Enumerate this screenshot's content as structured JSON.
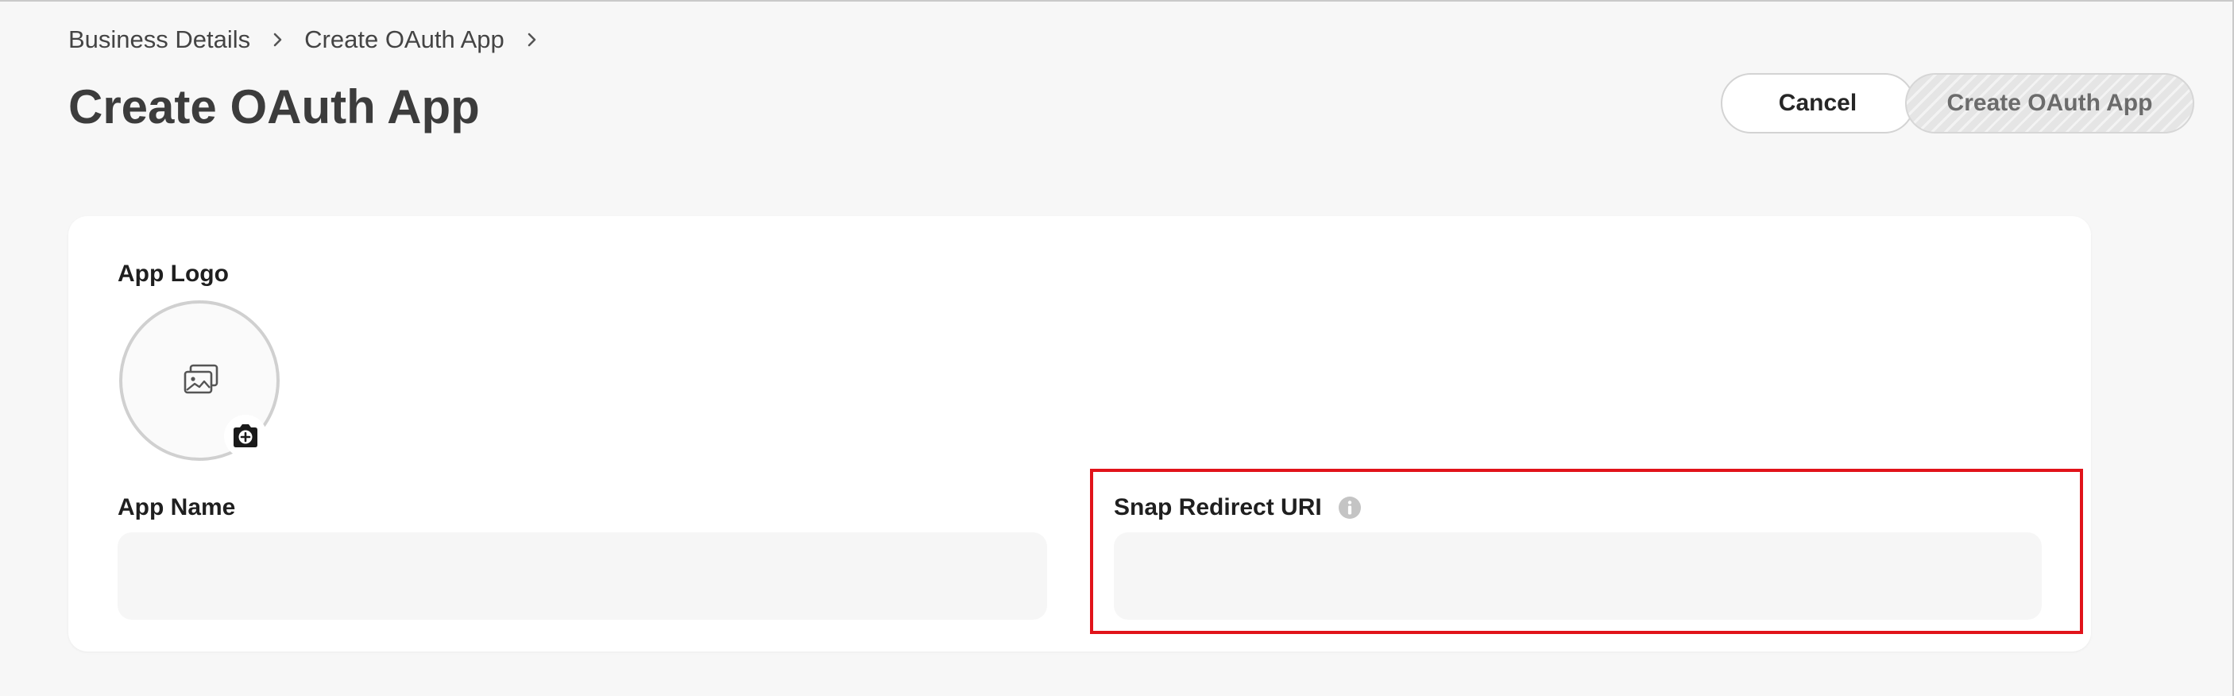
{
  "breadcrumb": {
    "items": [
      "Business Details",
      "Create OAuth App"
    ]
  },
  "page": {
    "title": "Create OAuth App"
  },
  "actions": {
    "cancel_label": "Cancel",
    "create_label": "Create OAuth App"
  },
  "form": {
    "app_logo": {
      "label": "App Logo",
      "placeholder_icon": "image-gallery-icon",
      "upload_icon": "camera-add-icon"
    },
    "app_name": {
      "label": "App Name",
      "value": "",
      "placeholder": ""
    },
    "snap_redirect_uri": {
      "label": "Snap Redirect URI",
      "info_icon": "info-icon",
      "value": "",
      "placeholder": ""
    }
  },
  "colors": {
    "page_background": "#f7f7f7",
    "card_background": "#ffffff",
    "highlight_border": "#e1131a",
    "disabled_button": "#e5e5e5"
  }
}
